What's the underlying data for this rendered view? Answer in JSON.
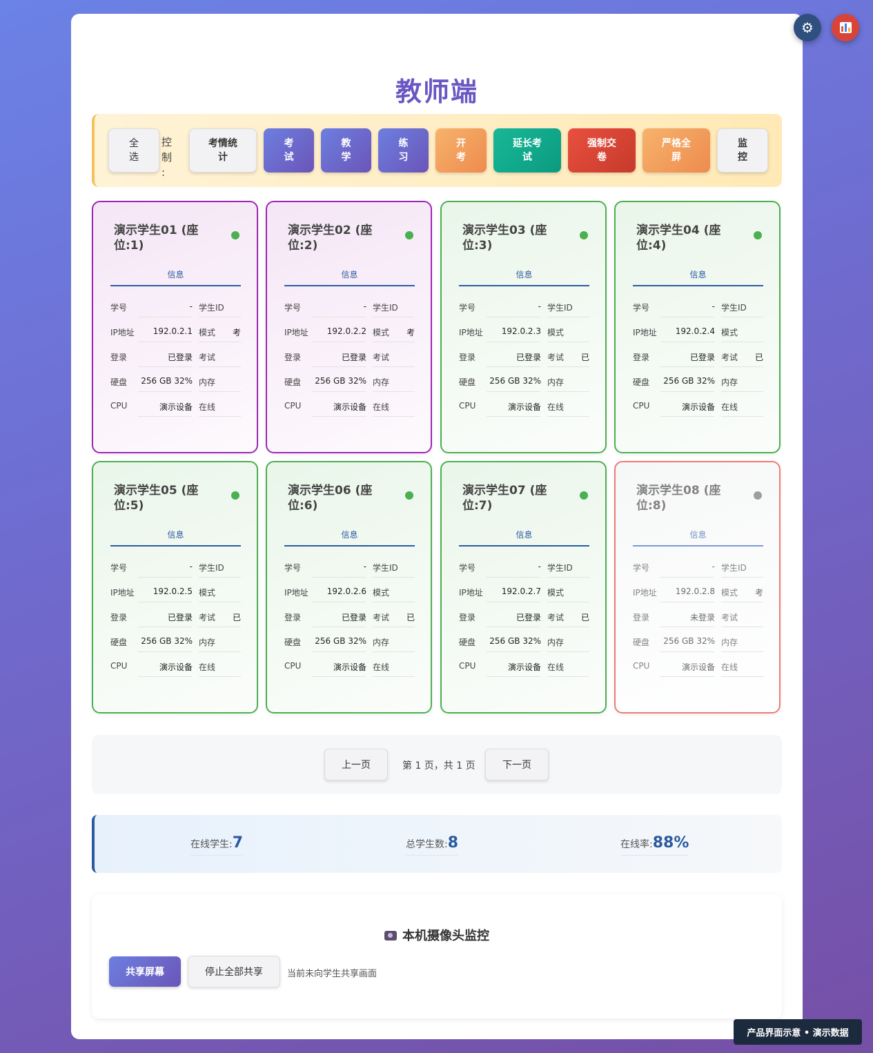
{
  "title": "教师端",
  "controls": {
    "select_all": "全选",
    "label": "控制:",
    "buttons": [
      "考情统计",
      "考试",
      "教学",
      "练习",
      "开考",
      "延长考试",
      "强制交卷",
      "严格全屏",
      "监控"
    ]
  },
  "card_tab": "信息",
  "field_labels": {
    "student_no": "学号",
    "student_id": "学生ID",
    "ip": "IP地址",
    "mode": "模式",
    "login": "登录",
    "exam": "考试",
    "disk": "硬盘",
    "memory": "内存",
    "cpu": "CPU",
    "online": "在线"
  },
  "students": [
    {
      "title": "演示学生01 (座位:1)",
      "student_no": "-",
      "ip": "192.0.2.1",
      "mode": "考",
      "login": "已登录",
      "exam": "",
      "disk": "256 GB 32%",
      "cpu": "演示设备",
      "online": true,
      "state": "purple"
    },
    {
      "title": "演示学生02 (座位:2)",
      "student_no": "-",
      "ip": "192.0.2.2",
      "mode": "考",
      "login": "已登录",
      "exam": "",
      "disk": "256 GB 32%",
      "cpu": "演示设备",
      "online": true,
      "state": "purple"
    },
    {
      "title": "演示学生03 (座位:3)",
      "student_no": "-",
      "ip": "192.0.2.3",
      "mode": "",
      "login": "已登录",
      "exam": "已",
      "disk": "256 GB 32%",
      "cpu": "演示设备",
      "online": true,
      "state": "green"
    },
    {
      "title": "演示学生04 (座位:4)",
      "student_no": "-",
      "ip": "192.0.2.4",
      "mode": "",
      "login": "已登录",
      "exam": "已",
      "disk": "256 GB 32%",
      "cpu": "演示设备",
      "online": true,
      "state": "green"
    },
    {
      "title": "演示学生05 (座位:5)",
      "student_no": "-",
      "ip": "192.0.2.5",
      "mode": "",
      "login": "已登录",
      "exam": "已",
      "disk": "256 GB 32%",
      "cpu": "演示设备",
      "online": true,
      "state": "green"
    },
    {
      "title": "演示学生06 (座位:6)",
      "student_no": "-",
      "ip": "192.0.2.6",
      "mode": "",
      "login": "已登录",
      "exam": "已",
      "disk": "256 GB 32%",
      "cpu": "演示设备",
      "online": true,
      "state": "green"
    },
    {
      "title": "演示学生07 (座位:7)",
      "student_no": "-",
      "ip": "192.0.2.7",
      "mode": "",
      "login": "已登录",
      "exam": "已",
      "disk": "256 GB 32%",
      "cpu": "演示设备",
      "online": true,
      "state": "green"
    },
    {
      "title": "演示学生08 (座位:8)",
      "student_no": "-",
      "ip": "192.0.2.8",
      "mode": "考",
      "login": "未登录",
      "exam": "",
      "disk": "256 GB 32%",
      "cpu": "演示设备",
      "online": false,
      "state": "offline"
    }
  ],
  "pagination": {
    "prev": "上一页",
    "status": "第 1 页，共 1 页",
    "next": "下一页"
  },
  "stats": {
    "online_label": "在线学生:",
    "online_value": "7",
    "total_label": "总学生数:",
    "total_value": "8",
    "rate_label": "在线率:",
    "rate_value": "88%"
  },
  "camera": {
    "title": "本机摄像头监控",
    "share_button": "共享屏幕",
    "stop_button": "停止全部共享",
    "status": "当前未向学生共享画面"
  },
  "footer_badge": "产品界面示意 • 演示数据",
  "icons": {
    "settings": "gear-icon",
    "stats": "bar-chart-icon",
    "camera": "camera-icon"
  },
  "colors": {
    "accent": "#6a57c3",
    "online": "#4caf50",
    "offline": "#9e9e9e",
    "selected": "#9c27b0",
    "offline_border": "#ef7a74",
    "info": "#2a5aa0"
  }
}
